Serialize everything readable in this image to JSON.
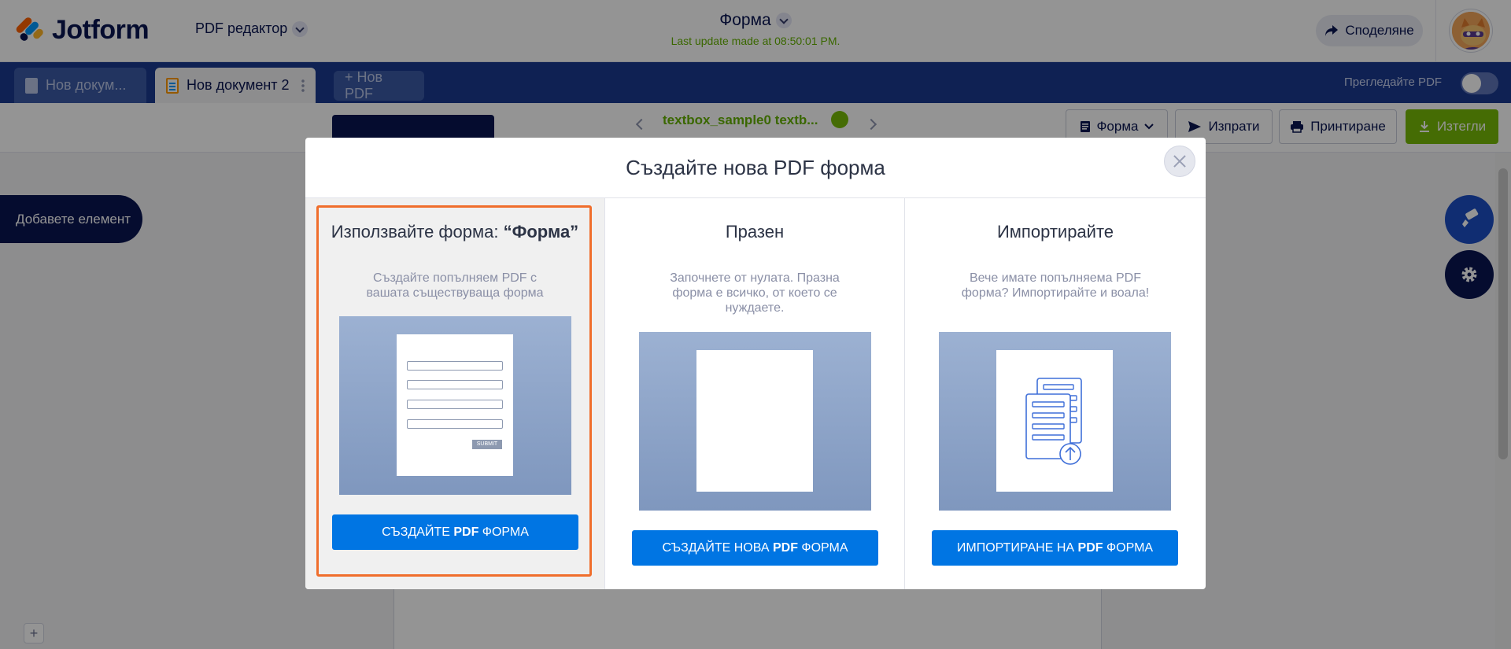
{
  "header": {
    "logo_text": "Jotform",
    "product_label": "PDF редактор",
    "form_title": "Форма",
    "last_update": "Last update made at 08:50:01 PM.",
    "share_label": "Споделяне"
  },
  "tabs": [
    {
      "label": "Нов докум..."
    },
    {
      "label": "Нов документ 2"
    },
    {
      "label": "+ Нов PDF"
    }
  ],
  "preview_toggle_label": "Прегледайте PDF",
  "toolbar": {
    "doc_name": "textbox_sample0 textb...",
    "forma_label": "Форма",
    "send_label": "Изпрати",
    "print_label": "Принтиране",
    "download_label": "Изтегли"
  },
  "workspace": {
    "add_element_label": "Добавете елемент",
    "zoom_in_label": "+"
  },
  "modal": {
    "title": "Създайте нова PDF форма",
    "options": [
      {
        "title_prefix": "Използвайте форма: ",
        "title_strong": "“Форма”",
        "description": "Създайте попълняем PDF с вашата съществуваща форма",
        "button_prefix": "СЪЗДАЙТЕ ",
        "button_strong": "PDF",
        "button_suffix": " ФОРМА",
        "submit_mini": "SUBMIT"
      },
      {
        "title": "Празен",
        "description": "Започнете от нулата. Празна форма е всичко, от което се нуждаете.",
        "button_prefix": "СЪЗДАЙТЕ НОВА ",
        "button_strong": "PDF",
        "button_suffix": " ФОРМА"
      },
      {
        "title": "Импортирайте",
        "description": "Вече имате попълняема PDF форма? Импортирайте и воала!",
        "button_prefix": "ИМПОРТИРАНЕ НА ",
        "button_strong": "PDF",
        "button_suffix": " ФОРМА"
      }
    ]
  },
  "icons": {
    "share": "share-arrow-icon",
    "send": "send-icon",
    "print": "printer-icon",
    "download": "download-icon",
    "forma": "form-doc-icon",
    "paint": "paint-roller-icon",
    "gear": "gear-icon",
    "close": "close-icon",
    "import": "document-upload-icon"
  },
  "colors": {
    "brand_navy": "#0a1551",
    "tab_bar": "#1a3a8f",
    "primary_button": "#0075e3",
    "highlight_border": "#f06e2c",
    "success_green": "#78bb07"
  }
}
